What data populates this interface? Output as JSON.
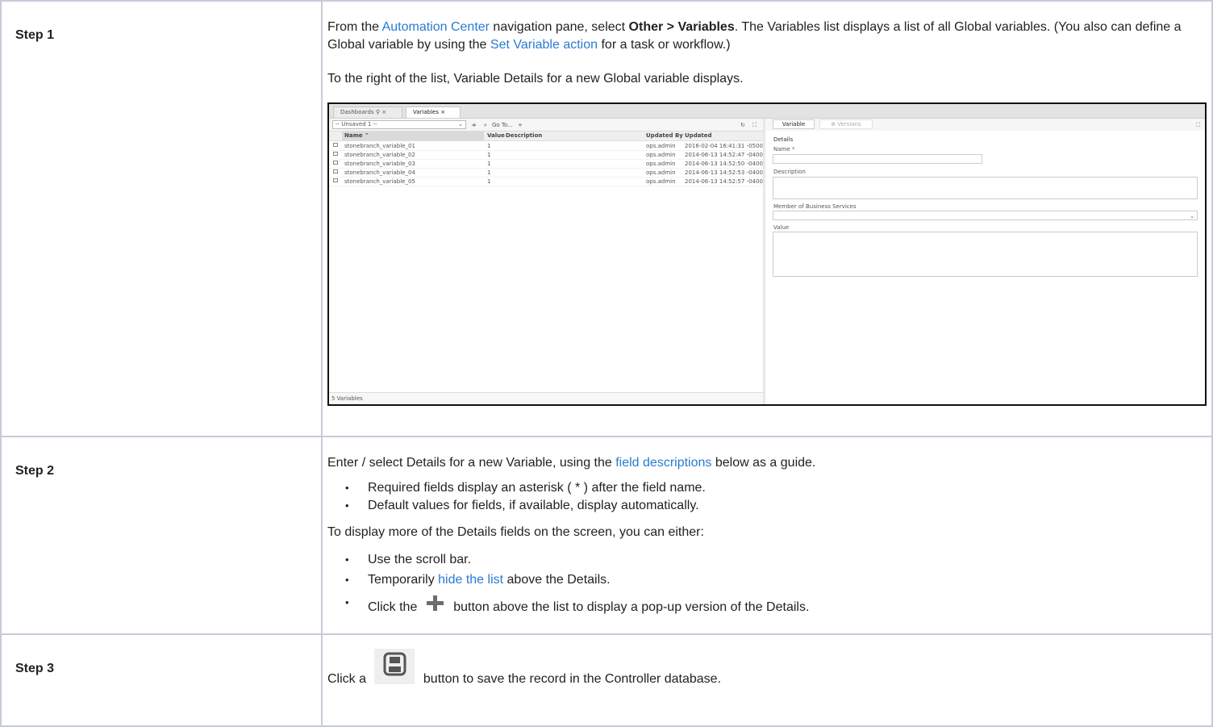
{
  "steps": [
    {
      "label": "Step 1",
      "p1": {
        "before_link": "From the ",
        "link": "Automation Center",
        "mid1": " navigation pane, select ",
        "bold": "Other > Variables",
        "mid2": ". The Variables list displays a list of all Global variables. (You also can define a Global variable by using the ",
        "link2": "Set Variable action",
        "after": " for a task or workflow.)"
      },
      "p2": "To the right of the list, Variable Details for a new Global variable displays."
    },
    {
      "label": "Step 2",
      "p1": {
        "before": "Enter / select Details for a new Variable, using the ",
        "link": "field descriptions",
        "after": " below as a guide."
      },
      "bullets1": [
        "Required fields display an asterisk ( * ) after the field name.",
        "Default values for fields, if available, display automatically."
      ],
      "p2": "To display more of the Details fields on the screen, you can either:",
      "bullet_scroll": "Use the scroll bar.",
      "bullet_hide": {
        "before": "Temporarily ",
        "link": "hide the list",
        "after": " above the Details."
      },
      "bullet_click": {
        "before": "Click the ",
        "after": " button above the list to display a pop-up version of the Details."
      }
    },
    {
      "label": "Step 3",
      "text": {
        "before": "Click a ",
        "after": " button to save the record in the Controller database."
      }
    }
  ],
  "screenshot": {
    "tabs": [
      "Dashboards",
      "Variables"
    ],
    "select_value": "-- Unsaved 1 --",
    "goto": "Go To...",
    "columns": [
      "Name",
      "Value",
      "Description",
      "Updated By",
      "Updated"
    ],
    "rows": [
      {
        "name": "stonebranch_variable_01",
        "value": "1",
        "by": "ops.admin",
        "updated": "2016-02-04 16:41:31 -0500"
      },
      {
        "name": "stonebranch_variable_02",
        "value": "1",
        "by": "ops.admin",
        "updated": "2014-06-13 14:52:47 -0400"
      },
      {
        "name": "stonebranch_variable_03",
        "value": "1",
        "by": "ops.admin",
        "updated": "2014-06-13 14:52:50 -0400"
      },
      {
        "name": "stonebranch_variable_04",
        "value": "1",
        "by": "ops.admin",
        "updated": "2014-06-13 14:52:53 -0400"
      },
      {
        "name": "stonebranch_variable_05",
        "value": "1",
        "by": "ops.admin",
        "updated": "2014-06-13 14:52:57 -0400"
      }
    ],
    "footer": "5 Variables",
    "detail_tabs": [
      "Variable",
      "Versions"
    ],
    "details_heading": "Details",
    "fields": [
      "Name",
      "Description",
      "Member of Business Services",
      "Value"
    ],
    "required_mark": "*"
  },
  "colors": {
    "link": "#2a7ad0",
    "border": "#c9cbd9"
  },
  "icons": [
    "plus-icon",
    "save-icon"
  ]
}
